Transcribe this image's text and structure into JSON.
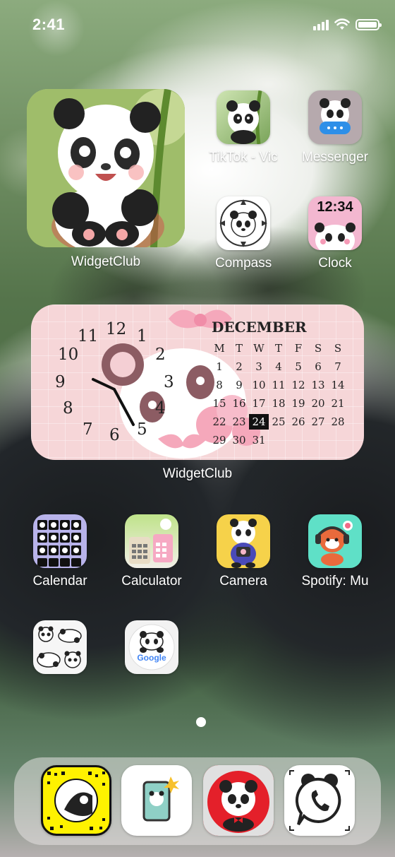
{
  "status_bar": {
    "time": "2:41"
  },
  "widgets": {
    "photo_widget_label": "WidgetClub",
    "calendar_widget": {
      "label": "WidgetClub",
      "month": "DECEMBER",
      "weekdays": [
        "M",
        "T",
        "W",
        "T",
        "F",
        "S",
        "S"
      ],
      "weeks": [
        [
          "1",
          "2",
          "3",
          "4",
          "5",
          "6",
          "7"
        ],
        [
          "8",
          "9",
          "10",
          "11",
          "12",
          "13",
          "14"
        ],
        [
          "15",
          "16",
          "17",
          "18",
          "19",
          "20",
          "21"
        ],
        [
          "22",
          "23",
          "24",
          "25",
          "26",
          "27",
          "28"
        ],
        [
          "29",
          "30",
          "31",
          "",
          "",
          "",
          ""
        ]
      ],
      "today": "24",
      "clock_numbers": [
        "12",
        "1",
        "2",
        "3",
        "4",
        "5",
        "6",
        "7",
        "8",
        "9",
        "10",
        "11"
      ]
    }
  },
  "apps": {
    "tiktok": "TikTok - Vic",
    "messenger": "Messenger",
    "compass": "Compass",
    "clock": "Clock",
    "clock_icon_time": "12:34",
    "calendar": "Calendar",
    "calculator": "Calculator",
    "camera": "Camera",
    "spotify": "Spotify: Mu"
  },
  "icons": {
    "google_text": "Google"
  },
  "colors": {
    "calendar_bg": "#f6d6d8",
    "clock_icon_bg": "#f3b7d0",
    "compass_bg": "#ffffff",
    "camera_bg": "#f6d24a",
    "spotify_bg": "#5fe0c7",
    "dock_snap_bg": "#fff200",
    "dock_red_bg": "#e4202a"
  }
}
